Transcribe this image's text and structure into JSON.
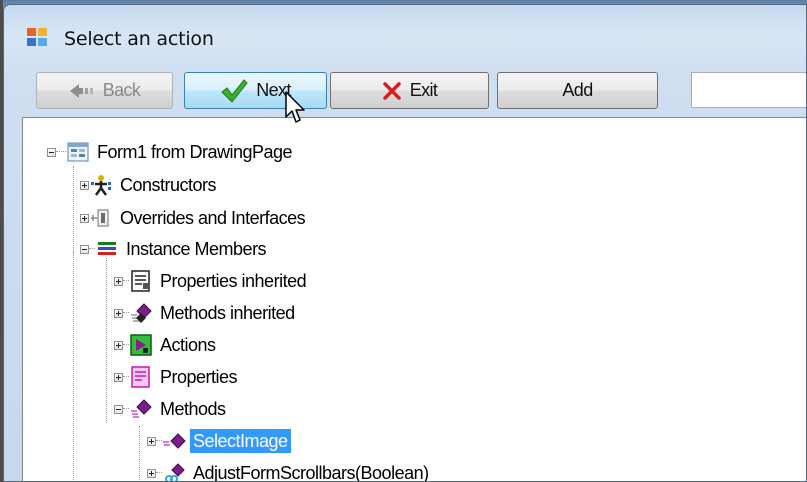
{
  "window": {
    "title": "Select an action"
  },
  "toolbar": {
    "back_label": "Back",
    "next_label": "Next",
    "exit_label": "Exit",
    "add_label": "Add",
    "search_value": ""
  },
  "tree": {
    "root": {
      "label": "Form1 from DrawingPage",
      "icon": "form-icon"
    },
    "constructors": {
      "label": "Constructors",
      "icon": "constructor-icon"
    },
    "overrides": {
      "label": "Overrides and Interfaces",
      "icon": "interface-icon"
    },
    "instance": {
      "label": "Instance Members",
      "icon": "members-icon"
    },
    "props_inherited": {
      "label": "Properties inherited",
      "icon": "properties-inherited-icon"
    },
    "methods_inherited": {
      "label": "Methods inherited",
      "icon": "methods-inherited-icon"
    },
    "actions": {
      "label": "Actions",
      "icon": "actions-icon"
    },
    "properties": {
      "label": "Properties",
      "icon": "properties-icon"
    },
    "methods": {
      "label": "Methods",
      "icon": "methods-icon"
    },
    "select_image": {
      "label": "SelectImage",
      "icon": "method-icon",
      "selected": true
    },
    "adjust_scrollbars": {
      "label": "AdjustFormScrollbars(Boolean)",
      "icon": "method-icon"
    }
  },
  "colors": {
    "selection": "#3399ff",
    "window_frame": "#c5d9ee",
    "next_check": "#3ab02c",
    "exit_x": "#d61f1f"
  }
}
